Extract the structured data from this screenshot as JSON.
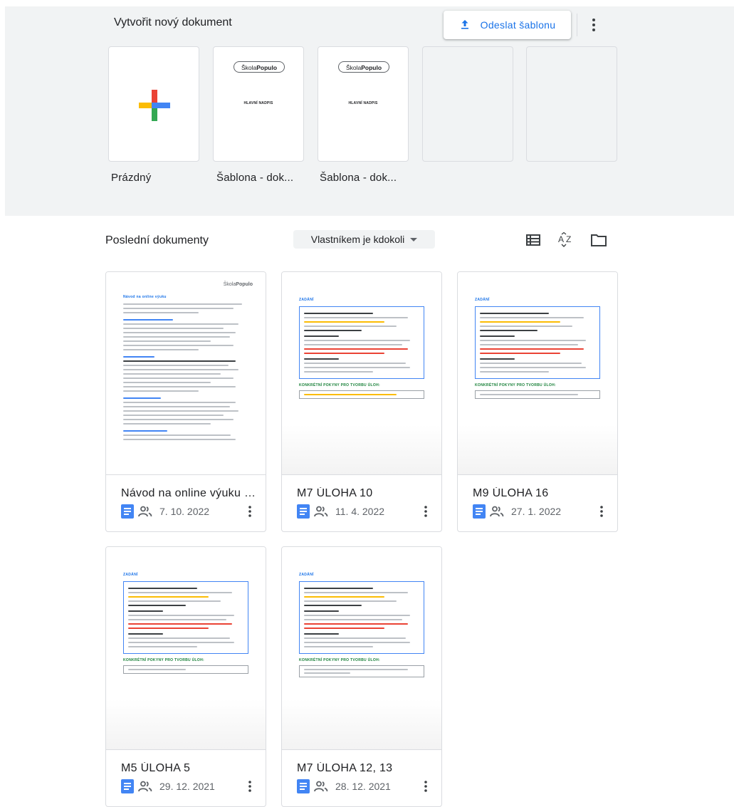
{
  "gallery": {
    "title": "Vytvořit nový dokument",
    "upload_label": "Odeslat šablonu",
    "templates": [
      {
        "label": "Prázdný"
      },
      {
        "label": "Šablona - dok...",
        "logo_left": "Škola",
        "logo_right": "Populo",
        "heading": "HLAVNÍ NADPIS"
      },
      {
        "label": "Šablona - dok...",
        "logo_left": "Škola",
        "logo_right": "Populo",
        "heading": "HLAVNÍ NADPIS"
      },
      {
        "label": ""
      },
      {
        "label": ""
      }
    ]
  },
  "recent": {
    "title": "Poslední dokumenty",
    "owner_filter": "Vlastníkem je kdokoli",
    "docs": [
      {
        "title": "Návod na online výuku pr...",
        "date": "7. 10. 2022"
      },
      {
        "title": "M7 ÚLOHA 10",
        "date": "11. 4. 2022"
      },
      {
        "title": "M9 ÚLOHA 16",
        "date": "27. 1. 2022"
      },
      {
        "title": "M5 ÚLOHA 5",
        "date": "29. 12. 2021"
      },
      {
        "title": "M7 ÚLOHA 12, 13",
        "date": "28. 12. 2021"
      }
    ]
  },
  "thumbs": {
    "guide_title": "Návod na online výuku",
    "task_title": "ZADÁNÍ",
    "task_instructions": "KONKRÉTNÍ POKYNY PRO TVORBU ÚLOH:",
    "logo_left": "Škola",
    "logo_right": "Populo"
  },
  "colors": {
    "accent": "#1a73e8",
    "doc_icon": "#4285f4",
    "gallery_bg": "#f1f3f4"
  },
  "icons": [
    "upload-icon",
    "more-vert-icon",
    "list-view-icon",
    "sort-az-icon",
    "folder-icon",
    "docs-file-icon",
    "shared-people-icon"
  ]
}
